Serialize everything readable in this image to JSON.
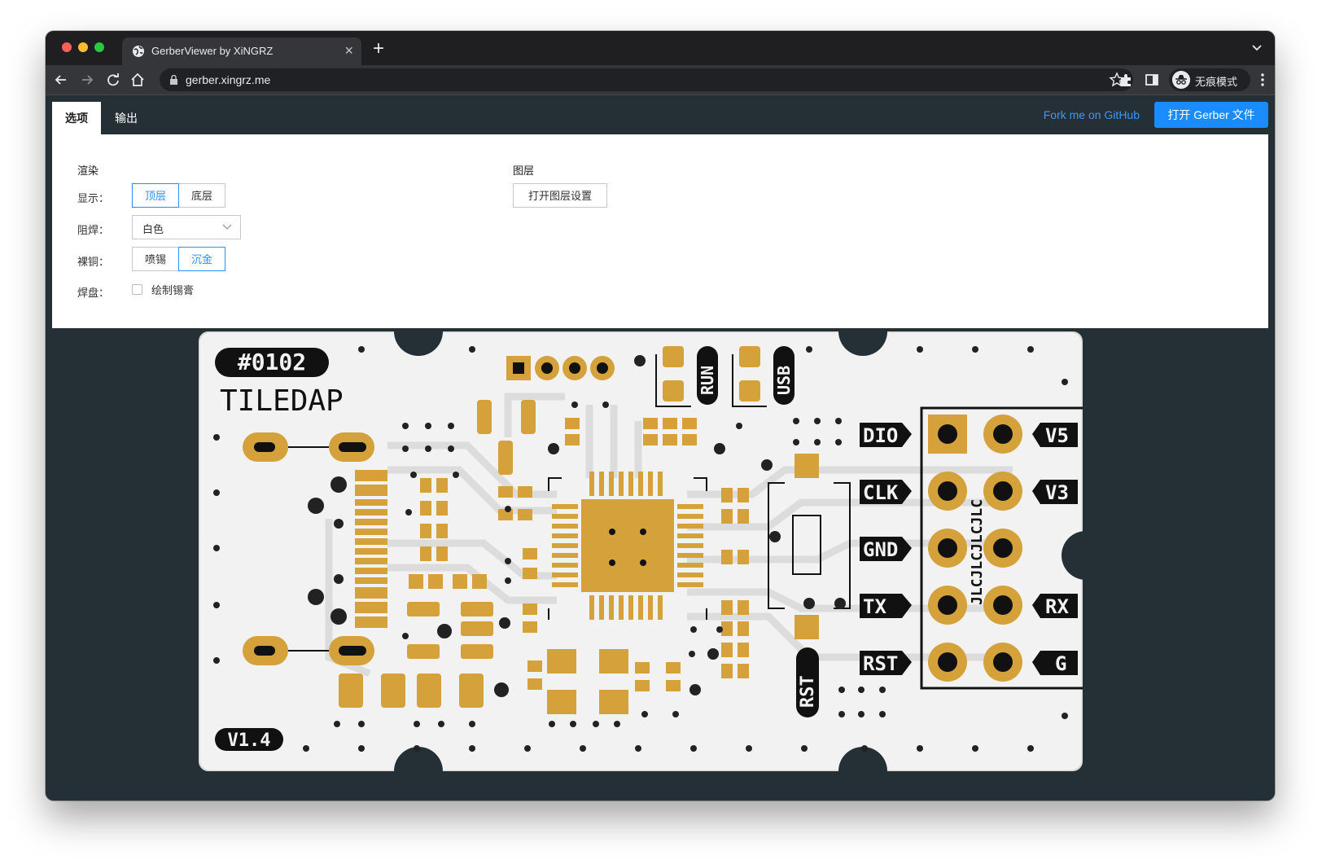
{
  "browser": {
    "tab_title": "GerberViewer by XiNGRZ",
    "url": "gerber.xingrz.me",
    "profile_label": "无痕模式"
  },
  "app": {
    "tabs": [
      "选项",
      "输出"
    ],
    "fork_link": "Fork me on GitHub",
    "open_button": "打开 Gerber 文件",
    "render": {
      "title": "渲染",
      "display_label": "显示：",
      "display_options": [
        "顶层",
        "底层"
      ],
      "display_selected": "顶层",
      "mask_label": "阻焊：",
      "mask_value": "白色",
      "copper_label": "裸铜：",
      "copper_options": [
        "喷锡",
        "沉金"
      ],
      "copper_selected": "沉金",
      "pad_label": "焊盘：",
      "paste_checkbox": "绘制锡膏"
    },
    "layers": {
      "title": "图层",
      "button": "打开图层设置"
    }
  },
  "pcb": {
    "board_id": "#0102",
    "board_name": "TILEDAP",
    "version": "V1.4",
    "left_labels": [
      "DIO",
      "CLK",
      "GND",
      "TX",
      "RST"
    ],
    "right_labels": [
      "V5",
      "V3",
      "",
      "RX",
      "G"
    ],
    "vertical_text": "JLCJLCJLCJLC",
    "button_labels": [
      "RUN",
      "USB",
      "RST"
    ],
    "colors": {
      "board": "#f2f2f2",
      "gold": "#d4a13a",
      "trace": "#dadada",
      "silk": "#111111"
    }
  }
}
